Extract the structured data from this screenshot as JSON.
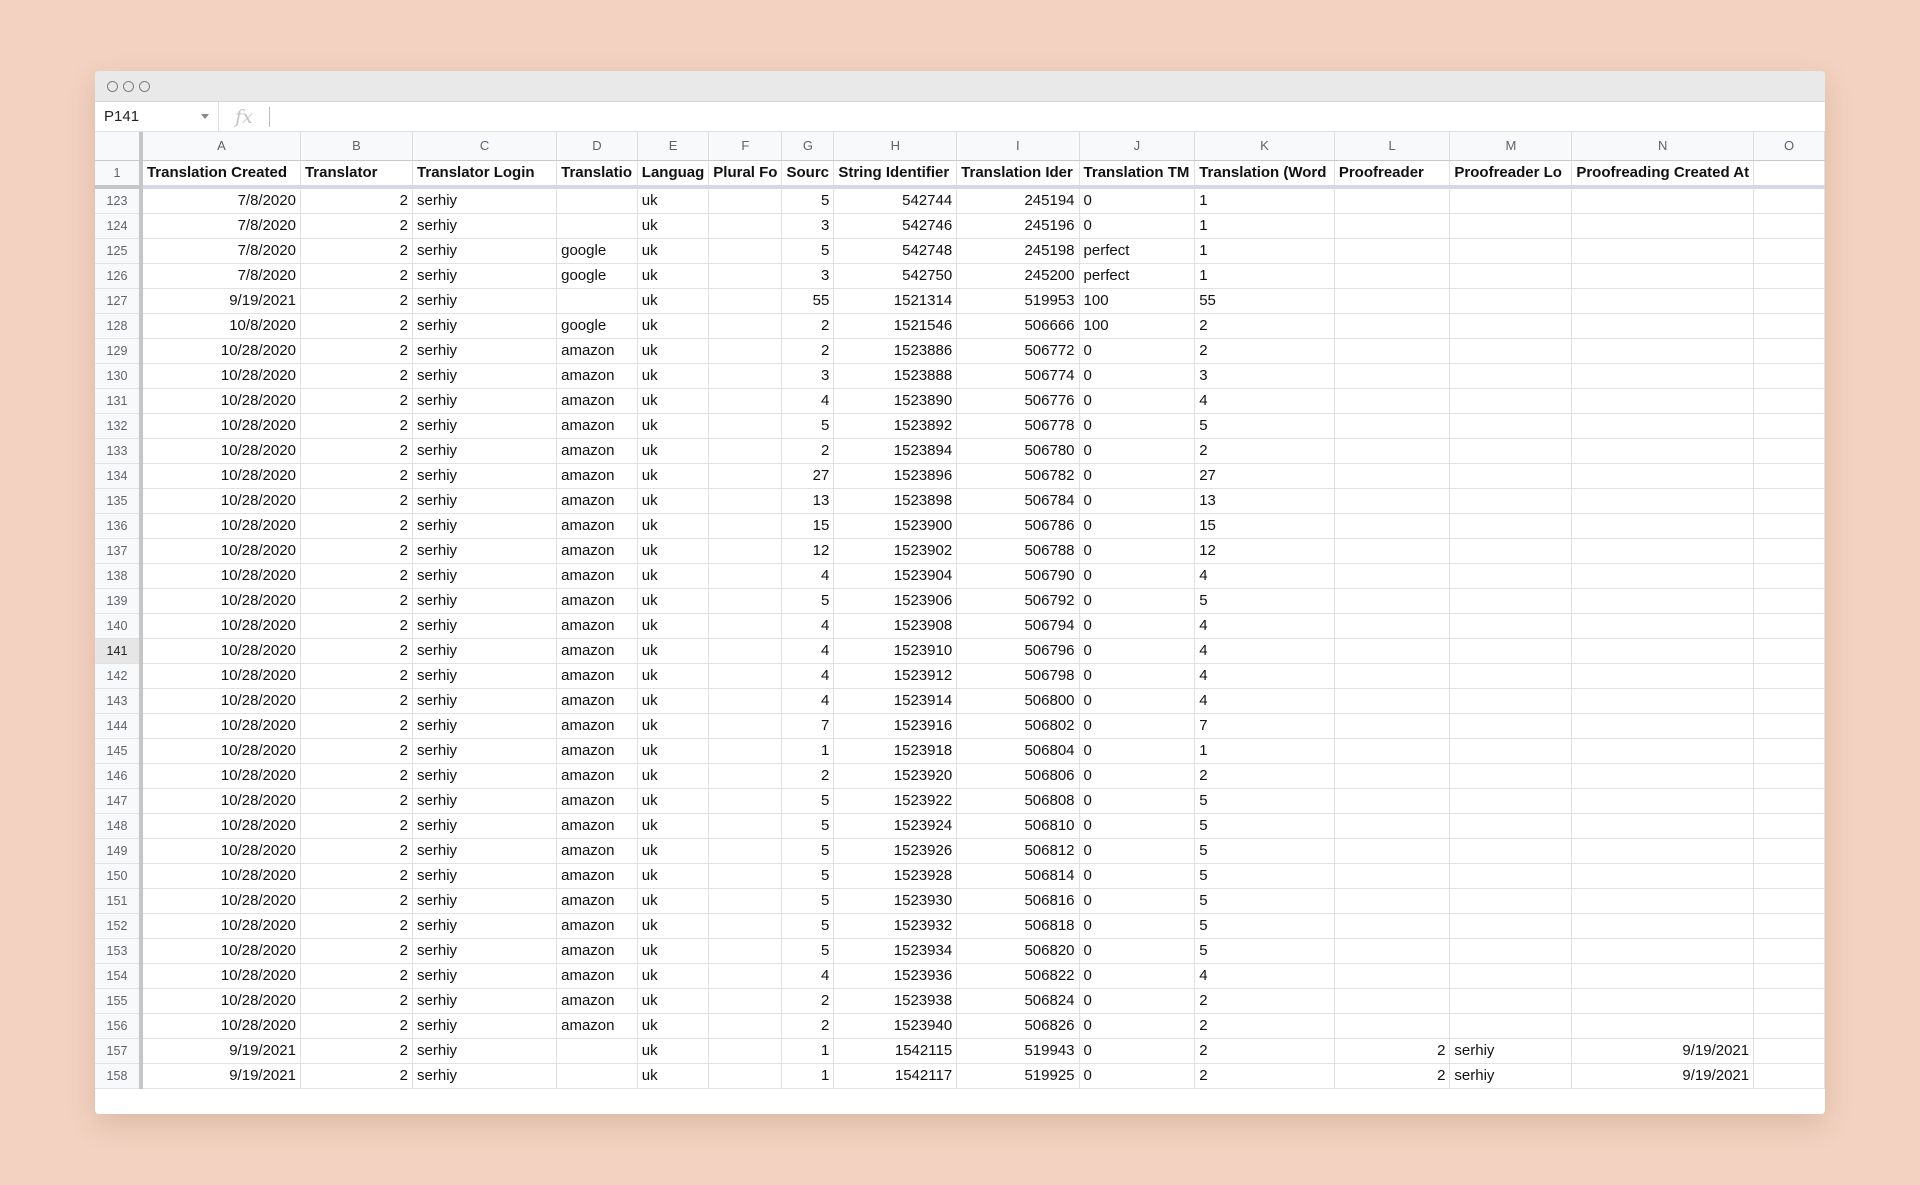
{
  "formula_bar": {
    "name_box": "P141",
    "fx_label": "fx",
    "formula": ""
  },
  "columns": [
    "A",
    "B",
    "C",
    "D",
    "E",
    "F",
    "G",
    "H",
    "I",
    "J",
    "K",
    "L",
    "M",
    "N",
    "O"
  ],
  "header_row": {
    "row_number": "1",
    "cells": [
      "Translation Created",
      "Translator",
      "Translator Login",
      "Translatio",
      "Languag",
      "Plural Fo",
      "Sourc",
      "String Identifier",
      "Translation Ider",
      "Translation TM",
      "Translation (Word",
      "Proofreader",
      "Proofreader Lo",
      "Proofreading Created At",
      ""
    ]
  },
  "selected_row": "141",
  "rows": [
    [
      "123",
      "7/8/2020",
      "2",
      "serhiy",
      "",
      "uk",
      "",
      "5",
      "542744",
      "245194",
      "0",
      "1",
      "",
      "",
      "",
      ""
    ],
    [
      "124",
      "7/8/2020",
      "2",
      "serhiy",
      "",
      "uk",
      "",
      "3",
      "542746",
      "245196",
      "0",
      "1",
      "",
      "",
      "",
      ""
    ],
    [
      "125",
      "7/8/2020",
      "2",
      "serhiy",
      "google",
      "uk",
      "",
      "5",
      "542748",
      "245198",
      "perfect",
      "1",
      "",
      "",
      "",
      ""
    ],
    [
      "126",
      "7/8/2020",
      "2",
      "serhiy",
      "google",
      "uk",
      "",
      "3",
      "542750",
      "245200",
      "perfect",
      "1",
      "",
      "",
      "",
      ""
    ],
    [
      "127",
      "9/19/2021",
      "2",
      "serhiy",
      "",
      "uk",
      "",
      "55",
      "1521314",
      "519953",
      "100",
      "55",
      "",
      "",
      "",
      ""
    ],
    [
      "128",
      "10/8/2020",
      "2",
      "serhiy",
      "google",
      "uk",
      "",
      "2",
      "1521546",
      "506666",
      "100",
      "2",
      "",
      "",
      "",
      ""
    ],
    [
      "129",
      "10/28/2020",
      "2",
      "serhiy",
      "amazon",
      "uk",
      "",
      "2",
      "1523886",
      "506772",
      "0",
      "2",
      "",
      "",
      "",
      ""
    ],
    [
      "130",
      "10/28/2020",
      "2",
      "serhiy",
      "amazon",
      "uk",
      "",
      "3",
      "1523888",
      "506774",
      "0",
      "3",
      "",
      "",
      "",
      ""
    ],
    [
      "131",
      "10/28/2020",
      "2",
      "serhiy",
      "amazon",
      "uk",
      "",
      "4",
      "1523890",
      "506776",
      "0",
      "4",
      "",
      "",
      "",
      ""
    ],
    [
      "132",
      "10/28/2020",
      "2",
      "serhiy",
      "amazon",
      "uk",
      "",
      "5",
      "1523892",
      "506778",
      "0",
      "5",
      "",
      "",
      "",
      ""
    ],
    [
      "133",
      "10/28/2020",
      "2",
      "serhiy",
      "amazon",
      "uk",
      "",
      "2",
      "1523894",
      "506780",
      "0",
      "2",
      "",
      "",
      "",
      ""
    ],
    [
      "134",
      "10/28/2020",
      "2",
      "serhiy",
      "amazon",
      "uk",
      "",
      "27",
      "1523896",
      "506782",
      "0",
      "27",
      "",
      "",
      "",
      ""
    ],
    [
      "135",
      "10/28/2020",
      "2",
      "serhiy",
      "amazon",
      "uk",
      "",
      "13",
      "1523898",
      "506784",
      "0",
      "13",
      "",
      "",
      "",
      ""
    ],
    [
      "136",
      "10/28/2020",
      "2",
      "serhiy",
      "amazon",
      "uk",
      "",
      "15",
      "1523900",
      "506786",
      "0",
      "15",
      "",
      "",
      "",
      ""
    ],
    [
      "137",
      "10/28/2020",
      "2",
      "serhiy",
      "amazon",
      "uk",
      "",
      "12",
      "1523902",
      "506788",
      "0",
      "12",
      "",
      "",
      "",
      ""
    ],
    [
      "138",
      "10/28/2020",
      "2",
      "serhiy",
      "amazon",
      "uk",
      "",
      "4",
      "1523904",
      "506790",
      "0",
      "4",
      "",
      "",
      "",
      ""
    ],
    [
      "139",
      "10/28/2020",
      "2",
      "serhiy",
      "amazon",
      "uk",
      "",
      "5",
      "1523906",
      "506792",
      "0",
      "5",
      "",
      "",
      "",
      ""
    ],
    [
      "140",
      "10/28/2020",
      "2",
      "serhiy",
      "amazon",
      "uk",
      "",
      "4",
      "1523908",
      "506794",
      "0",
      "4",
      "",
      "",
      "",
      ""
    ],
    [
      "141",
      "10/28/2020",
      "2",
      "serhiy",
      "amazon",
      "uk",
      "",
      "4",
      "1523910",
      "506796",
      "0",
      "4",
      "",
      "",
      "",
      ""
    ],
    [
      "142",
      "10/28/2020",
      "2",
      "serhiy",
      "amazon",
      "uk",
      "",
      "4",
      "1523912",
      "506798",
      "0",
      "4",
      "",
      "",
      "",
      ""
    ],
    [
      "143",
      "10/28/2020",
      "2",
      "serhiy",
      "amazon",
      "uk",
      "",
      "4",
      "1523914",
      "506800",
      "0",
      "4",
      "",
      "",
      "",
      ""
    ],
    [
      "144",
      "10/28/2020",
      "2",
      "serhiy",
      "amazon",
      "uk",
      "",
      "7",
      "1523916",
      "506802",
      "0",
      "7",
      "",
      "",
      "",
      ""
    ],
    [
      "145",
      "10/28/2020",
      "2",
      "serhiy",
      "amazon",
      "uk",
      "",
      "1",
      "1523918",
      "506804",
      "0",
      "1",
      "",
      "",
      "",
      ""
    ],
    [
      "146",
      "10/28/2020",
      "2",
      "serhiy",
      "amazon",
      "uk",
      "",
      "2",
      "1523920",
      "506806",
      "0",
      "2",
      "",
      "",
      "",
      ""
    ],
    [
      "147",
      "10/28/2020",
      "2",
      "serhiy",
      "amazon",
      "uk",
      "",
      "5",
      "1523922",
      "506808",
      "0",
      "5",
      "",
      "",
      "",
      ""
    ],
    [
      "148",
      "10/28/2020",
      "2",
      "serhiy",
      "amazon",
      "uk",
      "",
      "5",
      "1523924",
      "506810",
      "0",
      "5",
      "",
      "",
      "",
      ""
    ],
    [
      "149",
      "10/28/2020",
      "2",
      "serhiy",
      "amazon",
      "uk",
      "",
      "5",
      "1523926",
      "506812",
      "0",
      "5",
      "",
      "",
      "",
      ""
    ],
    [
      "150",
      "10/28/2020",
      "2",
      "serhiy",
      "amazon",
      "uk",
      "",
      "5",
      "1523928",
      "506814",
      "0",
      "5",
      "",
      "",
      "",
      ""
    ],
    [
      "151",
      "10/28/2020",
      "2",
      "serhiy",
      "amazon",
      "uk",
      "",
      "5",
      "1523930",
      "506816",
      "0",
      "5",
      "",
      "",
      "",
      ""
    ],
    [
      "152",
      "10/28/2020",
      "2",
      "serhiy",
      "amazon",
      "uk",
      "",
      "5",
      "1523932",
      "506818",
      "0",
      "5",
      "",
      "",
      "",
      ""
    ],
    [
      "153",
      "10/28/2020",
      "2",
      "serhiy",
      "amazon",
      "uk",
      "",
      "5",
      "1523934",
      "506820",
      "0",
      "5",
      "",
      "",
      "",
      ""
    ],
    [
      "154",
      "10/28/2020",
      "2",
      "serhiy",
      "amazon",
      "uk",
      "",
      "4",
      "1523936",
      "506822",
      "0",
      "4",
      "",
      "",
      "",
      ""
    ],
    [
      "155",
      "10/28/2020",
      "2",
      "serhiy",
      "amazon",
      "uk",
      "",
      "2",
      "1523938",
      "506824",
      "0",
      "2",
      "",
      "",
      "",
      ""
    ],
    [
      "156",
      "10/28/2020",
      "2",
      "serhiy",
      "amazon",
      "uk",
      "",
      "2",
      "1523940",
      "506826",
      "0",
      "2",
      "",
      "",
      "",
      ""
    ],
    [
      "157",
      "9/19/2021",
      "2",
      "serhiy",
      "",
      "uk",
      "",
      "1",
      "1542115",
      "519943",
      "0",
      "2",
      "2",
      "serhiy",
      "9/19/2021",
      ""
    ],
    [
      "158",
      "9/19/2021",
      "2",
      "serhiy",
      "",
      "uk",
      "",
      "1",
      "1542117",
      "519925",
      "0",
      "2",
      "2",
      "serhiy",
      "9/19/2021",
      ""
    ]
  ]
}
